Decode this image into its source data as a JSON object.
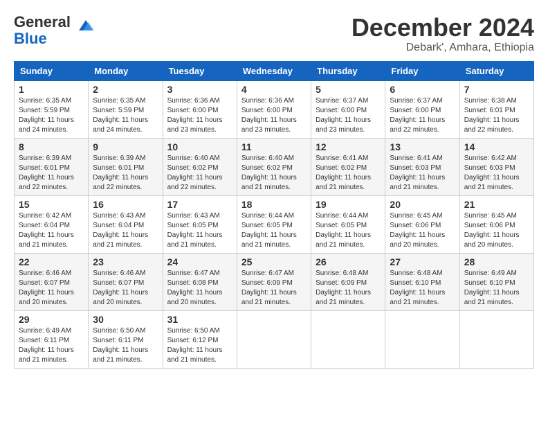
{
  "header": {
    "logo_general": "General",
    "logo_blue": "Blue",
    "month_title": "December 2024",
    "location": "Debark', Amhara, Ethiopia"
  },
  "days_of_week": [
    "Sunday",
    "Monday",
    "Tuesday",
    "Wednesday",
    "Thursday",
    "Friday",
    "Saturday"
  ],
  "weeks": [
    [
      {
        "day": "1",
        "sunrise": "6:35 AM",
        "sunset": "5:59 PM",
        "daylight": "11 hours and 24 minutes."
      },
      {
        "day": "2",
        "sunrise": "6:35 AM",
        "sunset": "5:59 PM",
        "daylight": "11 hours and 24 minutes."
      },
      {
        "day": "3",
        "sunrise": "6:36 AM",
        "sunset": "6:00 PM",
        "daylight": "11 hours and 23 minutes."
      },
      {
        "day": "4",
        "sunrise": "6:36 AM",
        "sunset": "6:00 PM",
        "daylight": "11 hours and 23 minutes."
      },
      {
        "day": "5",
        "sunrise": "6:37 AM",
        "sunset": "6:00 PM",
        "daylight": "11 hours and 23 minutes."
      },
      {
        "day": "6",
        "sunrise": "6:37 AM",
        "sunset": "6:00 PM",
        "daylight": "11 hours and 22 minutes."
      },
      {
        "day": "7",
        "sunrise": "6:38 AM",
        "sunset": "6:01 PM",
        "daylight": "11 hours and 22 minutes."
      }
    ],
    [
      {
        "day": "8",
        "sunrise": "6:39 AM",
        "sunset": "6:01 PM",
        "daylight": "11 hours and 22 minutes."
      },
      {
        "day": "9",
        "sunrise": "6:39 AM",
        "sunset": "6:01 PM",
        "daylight": "11 hours and 22 minutes."
      },
      {
        "day": "10",
        "sunrise": "6:40 AM",
        "sunset": "6:02 PM",
        "daylight": "11 hours and 22 minutes."
      },
      {
        "day": "11",
        "sunrise": "6:40 AM",
        "sunset": "6:02 PM",
        "daylight": "11 hours and 21 minutes."
      },
      {
        "day": "12",
        "sunrise": "6:41 AM",
        "sunset": "6:02 PM",
        "daylight": "11 hours and 21 minutes."
      },
      {
        "day": "13",
        "sunrise": "6:41 AM",
        "sunset": "6:03 PM",
        "daylight": "11 hours and 21 minutes."
      },
      {
        "day": "14",
        "sunrise": "6:42 AM",
        "sunset": "6:03 PM",
        "daylight": "11 hours and 21 minutes."
      }
    ],
    [
      {
        "day": "15",
        "sunrise": "6:42 AM",
        "sunset": "6:04 PM",
        "daylight": "11 hours and 21 minutes."
      },
      {
        "day": "16",
        "sunrise": "6:43 AM",
        "sunset": "6:04 PM",
        "daylight": "11 hours and 21 minutes."
      },
      {
        "day": "17",
        "sunrise": "6:43 AM",
        "sunset": "6:05 PM",
        "daylight": "11 hours and 21 minutes."
      },
      {
        "day": "18",
        "sunrise": "6:44 AM",
        "sunset": "6:05 PM",
        "daylight": "11 hours and 21 minutes."
      },
      {
        "day": "19",
        "sunrise": "6:44 AM",
        "sunset": "6:05 PM",
        "daylight": "11 hours and 21 minutes."
      },
      {
        "day": "20",
        "sunrise": "6:45 AM",
        "sunset": "6:06 PM",
        "daylight": "11 hours and 20 minutes."
      },
      {
        "day": "21",
        "sunrise": "6:45 AM",
        "sunset": "6:06 PM",
        "daylight": "11 hours and 20 minutes."
      }
    ],
    [
      {
        "day": "22",
        "sunrise": "6:46 AM",
        "sunset": "6:07 PM",
        "daylight": "11 hours and 20 minutes."
      },
      {
        "day": "23",
        "sunrise": "6:46 AM",
        "sunset": "6:07 PM",
        "daylight": "11 hours and 20 minutes."
      },
      {
        "day": "24",
        "sunrise": "6:47 AM",
        "sunset": "6:08 PM",
        "daylight": "11 hours and 20 minutes."
      },
      {
        "day": "25",
        "sunrise": "6:47 AM",
        "sunset": "6:09 PM",
        "daylight": "11 hours and 21 minutes."
      },
      {
        "day": "26",
        "sunrise": "6:48 AM",
        "sunset": "6:09 PM",
        "daylight": "11 hours and 21 minutes."
      },
      {
        "day": "27",
        "sunrise": "6:48 AM",
        "sunset": "6:10 PM",
        "daylight": "11 hours and 21 minutes."
      },
      {
        "day": "28",
        "sunrise": "6:49 AM",
        "sunset": "6:10 PM",
        "daylight": "11 hours and 21 minutes."
      }
    ],
    [
      {
        "day": "29",
        "sunrise": "6:49 AM",
        "sunset": "6:11 PM",
        "daylight": "11 hours and 21 minutes."
      },
      {
        "day": "30",
        "sunrise": "6:50 AM",
        "sunset": "6:11 PM",
        "daylight": "11 hours and 21 minutes."
      },
      {
        "day": "31",
        "sunrise": "6:50 AM",
        "sunset": "6:12 PM",
        "daylight": "11 hours and 21 minutes."
      },
      null,
      null,
      null,
      null
    ]
  ]
}
